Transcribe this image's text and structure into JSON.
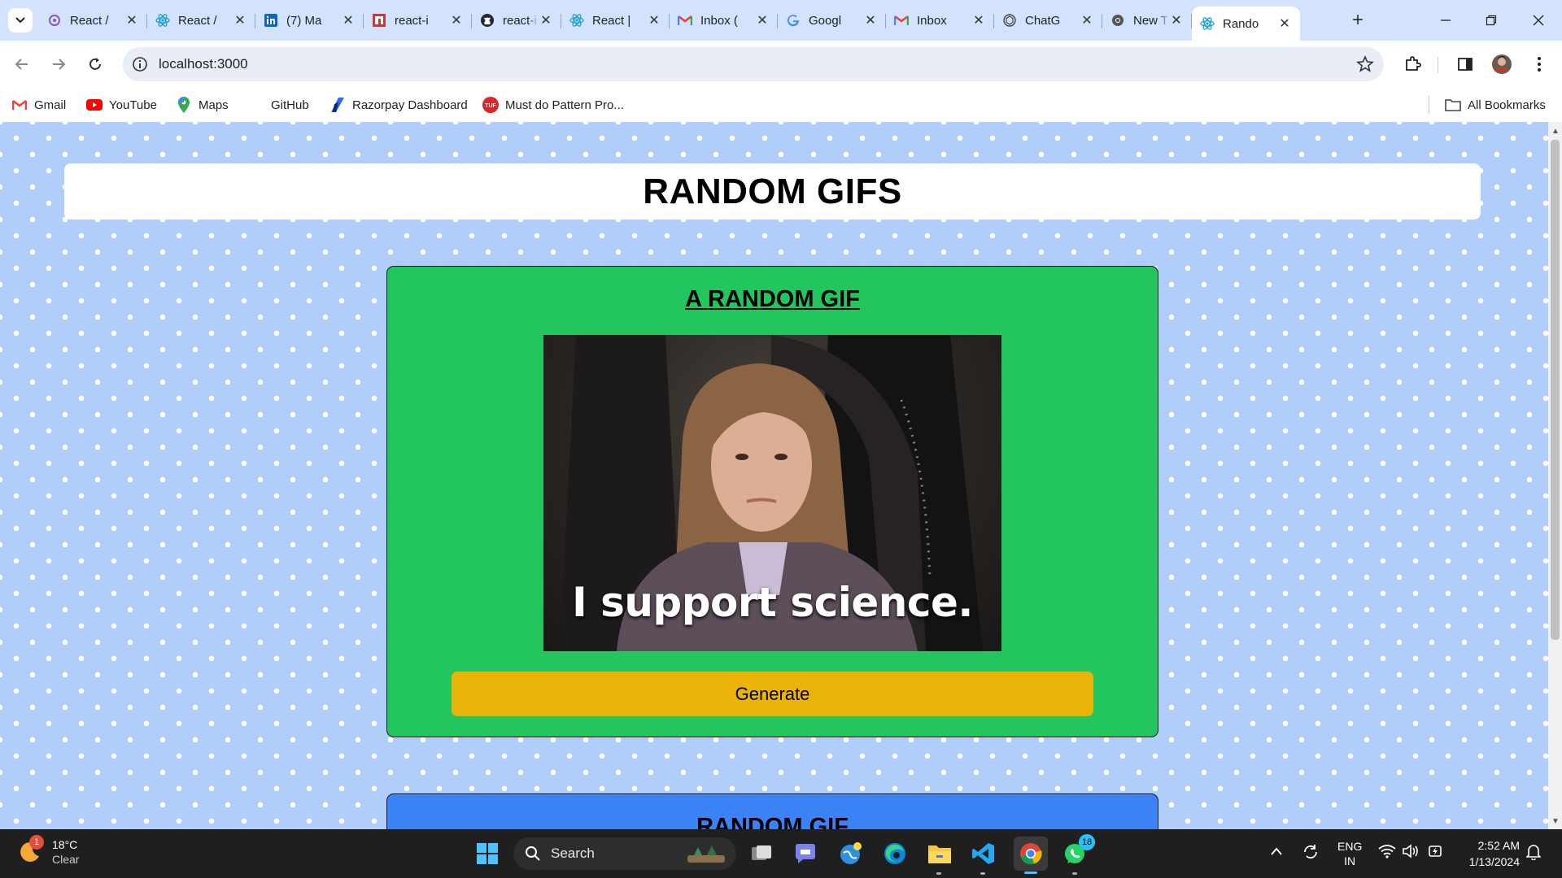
{
  "browser": {
    "tabs": [
      {
        "title": "React /",
        "icon": "threads-icon",
        "active": false
      },
      {
        "title": "React /",
        "icon": "react-icon",
        "active": false
      },
      {
        "title": "(7) Ma",
        "icon": "linkedin-icon",
        "active": false
      },
      {
        "title": "react-i",
        "icon": "npm-icon",
        "active": false
      },
      {
        "title": "react-i",
        "icon": "github-icon",
        "active": false
      },
      {
        "title": "React |",
        "icon": "react-icon",
        "active": false
      },
      {
        "title": "Inbox (",
        "icon": "gmail-icon",
        "active": false
      },
      {
        "title": "Googl",
        "icon": "google-icon",
        "active": false
      },
      {
        "title": "Inbox",
        "icon": "gmail-icon",
        "active": false
      },
      {
        "title": "ChatG",
        "icon": "chatgpt-icon",
        "active": false
      },
      {
        "title": "New T",
        "icon": "chrome-icon",
        "active": false
      },
      {
        "title": "Rando",
        "icon": "react-icon",
        "active": true
      }
    ],
    "url": "localhost:3000",
    "bookmarks": [
      {
        "label": "Gmail",
        "icon": "gmail-icon"
      },
      {
        "label": "YouTube",
        "icon": "youtube-icon"
      },
      {
        "label": "Maps",
        "icon": "maps-icon"
      },
      {
        "label": "GitHub",
        "icon": "github-icon"
      },
      {
        "label": "Razorpay Dashboard",
        "icon": "razorpay-icon"
      },
      {
        "label": "Must do Pattern Pro...",
        "icon": "tuf-icon"
      }
    ],
    "all_bookmarks_label": "All Bookmarks",
    "accent": "#d3e3fd"
  },
  "page": {
    "title": "RANDOM GIFS",
    "card1": {
      "heading": "A RANDOM GIF",
      "gif_caption": "I support science.",
      "button_label": "Generate",
      "bg_color": "#22c55e",
      "button_color": "#eab308"
    },
    "card2": {
      "heading": "RANDOM GIF",
      "bg_color": "#3b82f6"
    },
    "background_color": "#b1cdf9"
  },
  "taskbar": {
    "weather_badge": "1",
    "temperature": "18°C",
    "condition": "Clear",
    "search_placeholder": "Search",
    "whatsapp_badge": "18",
    "lang_top": "ENG",
    "lang_bottom": "IN",
    "time": "2:52 AM",
    "date": "1/13/2024"
  }
}
